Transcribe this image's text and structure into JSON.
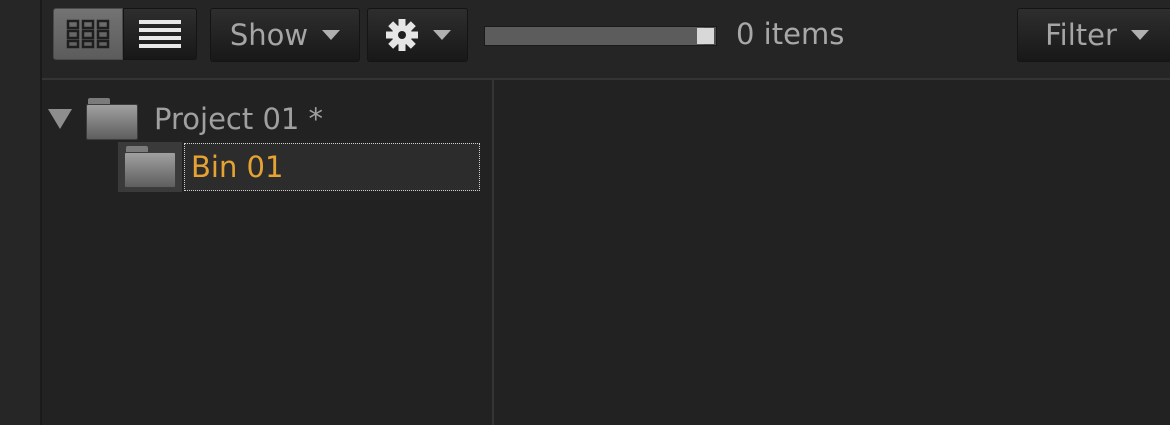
{
  "toolbar": {
    "show_label": "Show",
    "filter_label": "Filter",
    "items_count": "0 items",
    "thumbnail_size": 0.95,
    "icons": {
      "grid_view": "grid-icon",
      "list_view": "list-icon",
      "settings": "gear-icon",
      "dropdown": "caret-down-icon"
    }
  },
  "tree": {
    "items": [
      {
        "label": "Project 01 *",
        "expanded": true,
        "icon": "folder-icon"
      },
      {
        "label": "Bin 01",
        "selected": true,
        "icon": "folder-icon"
      }
    ]
  },
  "colors": {
    "background": "#222222",
    "selected_text": "#e6a233",
    "text": "#a0a0a0"
  }
}
